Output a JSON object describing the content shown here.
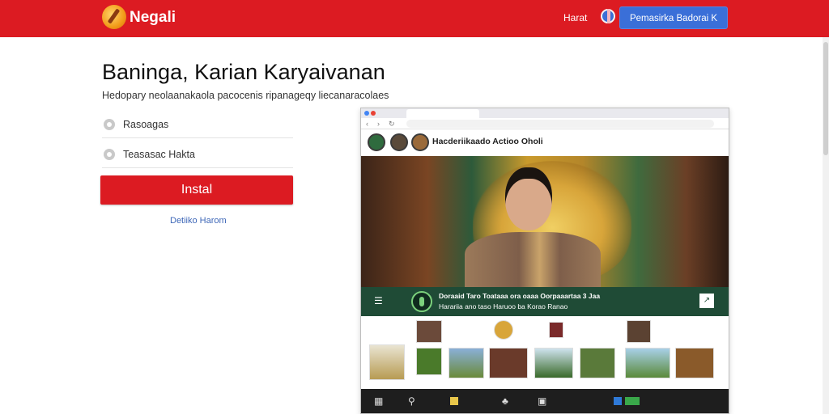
{
  "header": {
    "brand": "Negali",
    "nav_link": "Harat",
    "cta": "Pemasirka Badorai K",
    "colors": {
      "bar": "#dc1b22",
      "cta": "#3a6fd8"
    },
    "icons": [
      "app-logo-icon",
      "globe-icon"
    ]
  },
  "main": {
    "title": "Baninga, Karian Karyaivanan",
    "subtitle": "Hedopary neolaanakaola pacocenis ripanageqy liecanaracolaes",
    "options": [
      {
        "label": "Rasoagas",
        "icon": "radio-icon"
      },
      {
        "label": "Teasasac Hakta",
        "icon": "radio-icon"
      }
    ],
    "install_button": "Instal",
    "secondary_link": "Detiiko Harom"
  },
  "preview": {
    "header_text": "Hacderiikaado Actioo Oholi",
    "banner_line1": "Doraaid Taro Toataaa ora oaaa Oorpaaartaa 3 Jaa",
    "banner_line2": "Harariia ano taso Haruoo ba Korao Ranao",
    "menu_icon": "menu-icon",
    "expand_icon": "expand-icon",
    "taskbar_icons": [
      "windows-icon",
      "search-icon",
      "folder-icon",
      "recycle-icon",
      "camera-icon"
    ]
  }
}
